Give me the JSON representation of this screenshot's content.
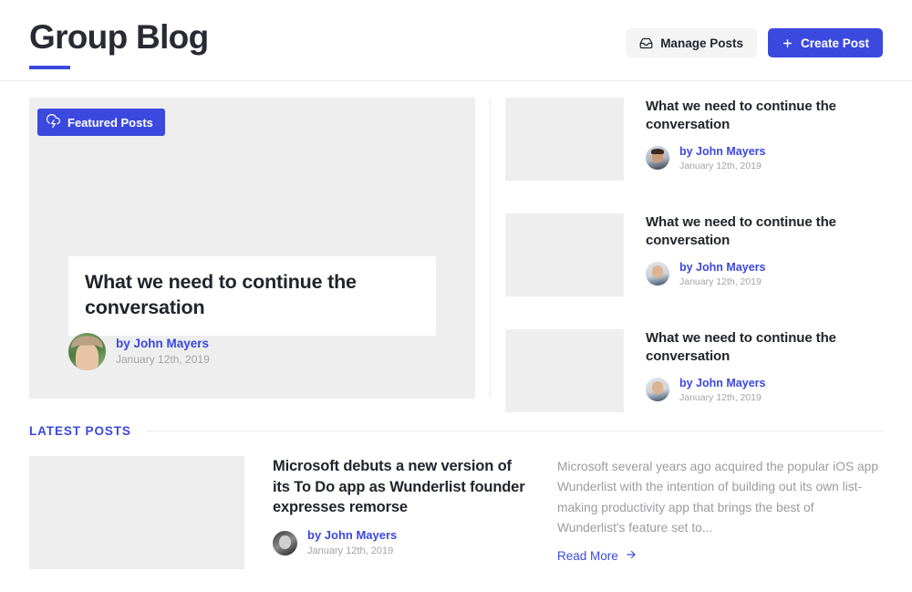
{
  "header": {
    "title": "Group Blog",
    "manage_posts_label": "Manage Posts",
    "manage_posts_icon": "inbox-icon",
    "create_post_label": "Create Post",
    "create_post_icon": "plus-icon",
    "accent_color": "#3b49df"
  },
  "featured": {
    "badge_label": "Featured Posts",
    "badge_icon": "cloud-lightning-icon",
    "post": {
      "title": "What we need to continue the conversation",
      "author": "by John Mayers",
      "date": "January 12th, 2019",
      "avatar": "avatar-woman-green-background"
    }
  },
  "sidebar_posts": [
    {
      "title": "What we need to continue the conversation",
      "author": "by John Mayers",
      "date": "January 12th, 2019",
      "avatar": "avatar-man-suit"
    },
    {
      "title": "What we need to continue the conversation",
      "author": "by John Mayers",
      "date": "January 12th, 2019",
      "avatar": "avatar-man-bald"
    },
    {
      "title": "What we need to continue the conversation",
      "author": "by John Mayers",
      "date": "January 12th, 2019",
      "avatar": "avatar-man-bald"
    }
  ],
  "latest": {
    "section_label": "LATEST POSTS",
    "posts": [
      {
        "title": "Microsoft debuts a new version of its To Do app as Wunderlist founder expresses remorse",
        "author": "by John Mayers",
        "date": "January 12th, 2019",
        "avatar": "avatar-bw-portrait",
        "excerpt": "Microsoft several years ago acquired the popular iOS app Wunderlist with the intention of building out its own list-making productivity app that brings the best of Wunderlist's feature set to...",
        "read_more_label": "Read More",
        "read_more_icon": "arrow-right-icon"
      }
    ]
  }
}
